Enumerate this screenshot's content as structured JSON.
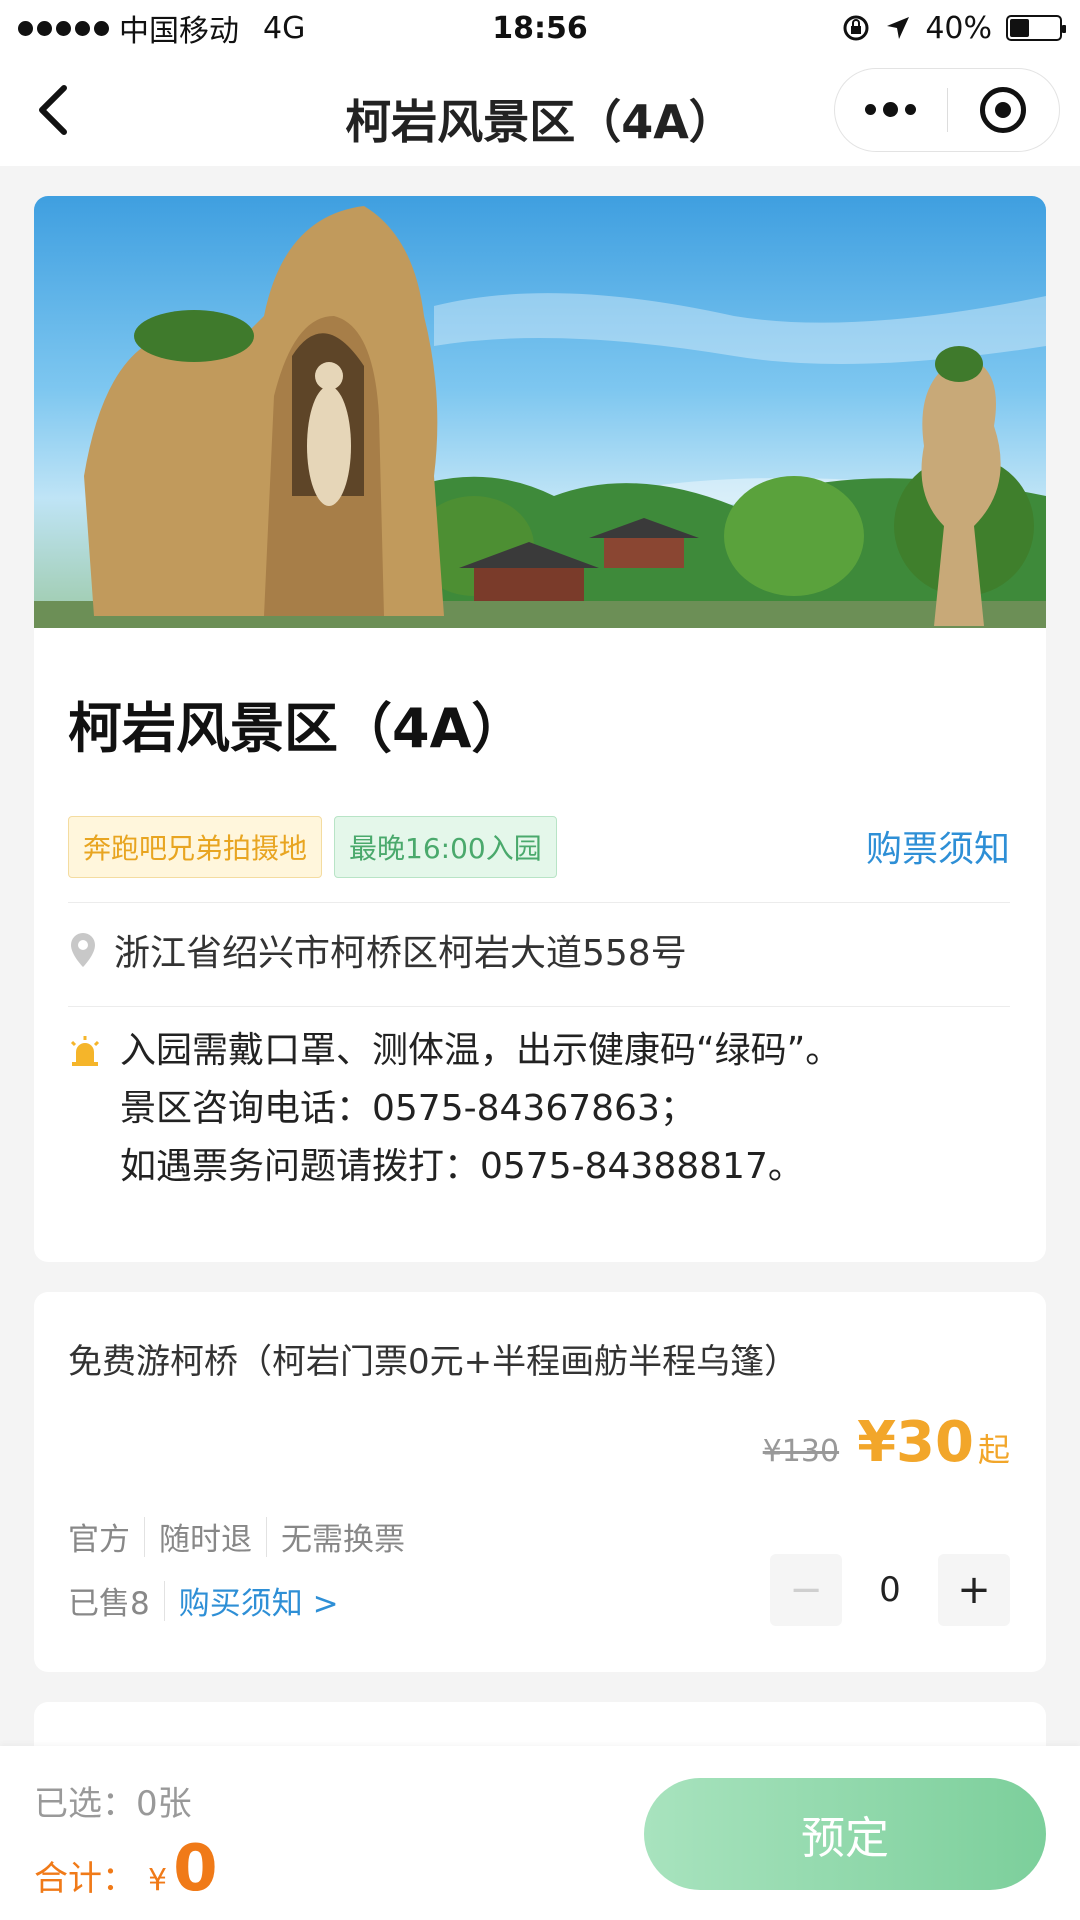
{
  "status_bar": {
    "carrier": "中国移动",
    "network": "4G",
    "time": "18:56",
    "battery": "40%",
    "battery_level": 0.4
  },
  "nav": {
    "title": "柯岩风景区（4A）"
  },
  "attraction": {
    "title": "柯岩风景区（4A）",
    "tags": [
      "奔跑吧兄弟拍摄地",
      "最晚16:00入园"
    ],
    "notice_link": "购票须知",
    "address": "浙江省绍兴市柯桥区柯岩大道558号",
    "alert_lines": [
      "入园需戴口罩、测体温，出示健康码“绿码”。",
      "景区咨询电话：0575-84367863；",
      "如遇票务问题请拨打：0575-84388817。"
    ]
  },
  "ticket": {
    "name": "免费游柯桥（柯岩门票0元+半程画舫半程乌篷）",
    "original_price": "¥130",
    "price": "¥30",
    "price_suffix": "起",
    "features": [
      "官方",
      "随时退",
      "无需换票"
    ],
    "sold": "已售8",
    "buy_notice": "购买须知 >",
    "quantity": "0",
    "minus": "−",
    "plus": "+"
  },
  "bottom_bar": {
    "selected": "已选：0张",
    "total_label": "合计：",
    "total_currency": "¥",
    "total_value": "0",
    "book_button": "预定"
  },
  "colors": {
    "accent_blue": "#2e8fd6",
    "price_orange": "#f2a62a",
    "total_orange": "#f07a18",
    "book_green": "#7ccf9b"
  }
}
